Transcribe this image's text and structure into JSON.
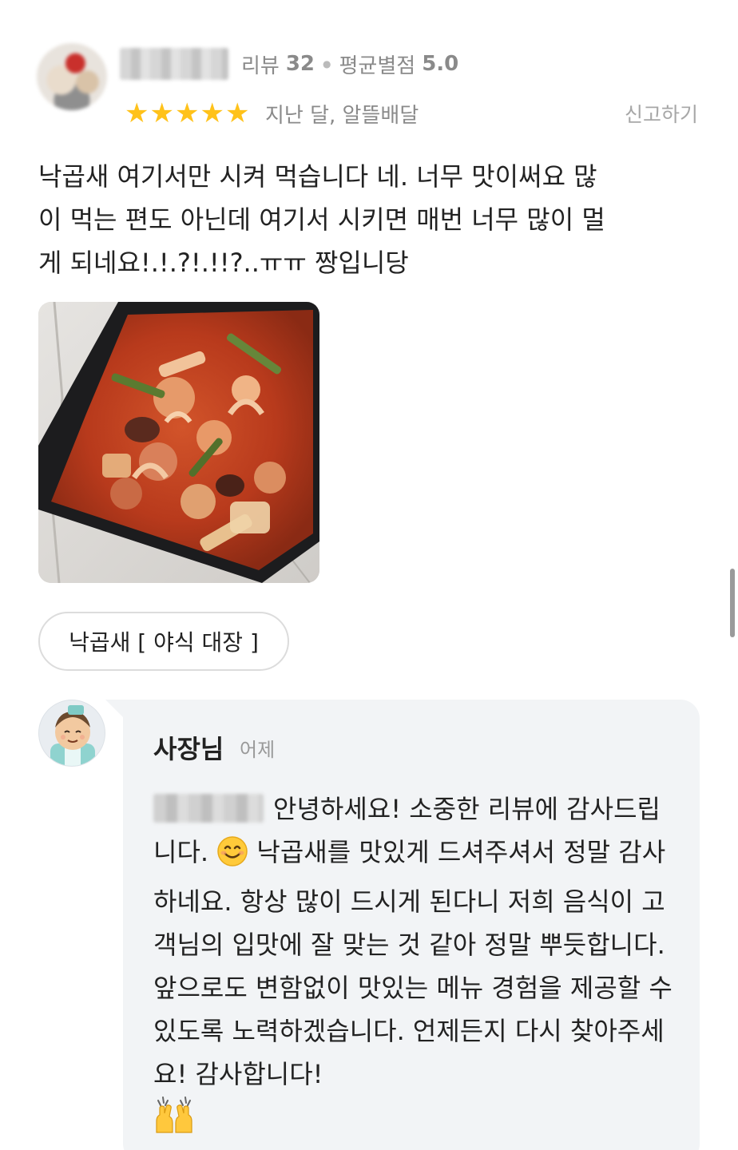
{
  "review": {
    "user_stats": {
      "review_label": "리뷰",
      "review_count": "32",
      "avg_label": "평균별점",
      "avg_rating": "5.0"
    },
    "rating": 5,
    "stars": [
      "★",
      "★",
      "★",
      "★",
      "★"
    ],
    "date_text": "지난 달, 알뜰배달",
    "report_label": "신고하기",
    "text": "낙곱새 여기서만 시켜 먹습니다 네. 너무 맛이써요 많\n이 먹는 편도 아닌데 여기서 시키면 매번 너무 많이 멀\n게 되네요!.!.?!.!!?..ㅠㅠ 짱입니당",
    "photo_icon": "food-photo-icon",
    "menu_chip": "낙곱새 [ 야식 대장 ]"
  },
  "owner_reply": {
    "name": "사장님",
    "date": "어제",
    "text_part1": "안녕하세요! 소중한 리뷰에 감사드립니다.",
    "text_part2": "낙곱새를 맛있게 드셔주셔서 정말 감사하네요. 항상 많이 드시게 된다니 저희 음식이 고객님의 입맛에 잘 맞는 것 같아 정말 뿌듯합니다. 앞으로도 변함없이 맛있는 메뉴 경험을 제공할 수 있도록 노력하겠습니다. 언제든지 다시 찾아주세요! 감사합니다!",
    "smile_icon": "smiling-face-emoji-icon",
    "hands_icon": "raised-hands-emoji-icon"
  },
  "colors": {
    "star": "#ffc21a",
    "muted_text": "#8a8a8a",
    "reply_bg": "#f2f4f6"
  }
}
